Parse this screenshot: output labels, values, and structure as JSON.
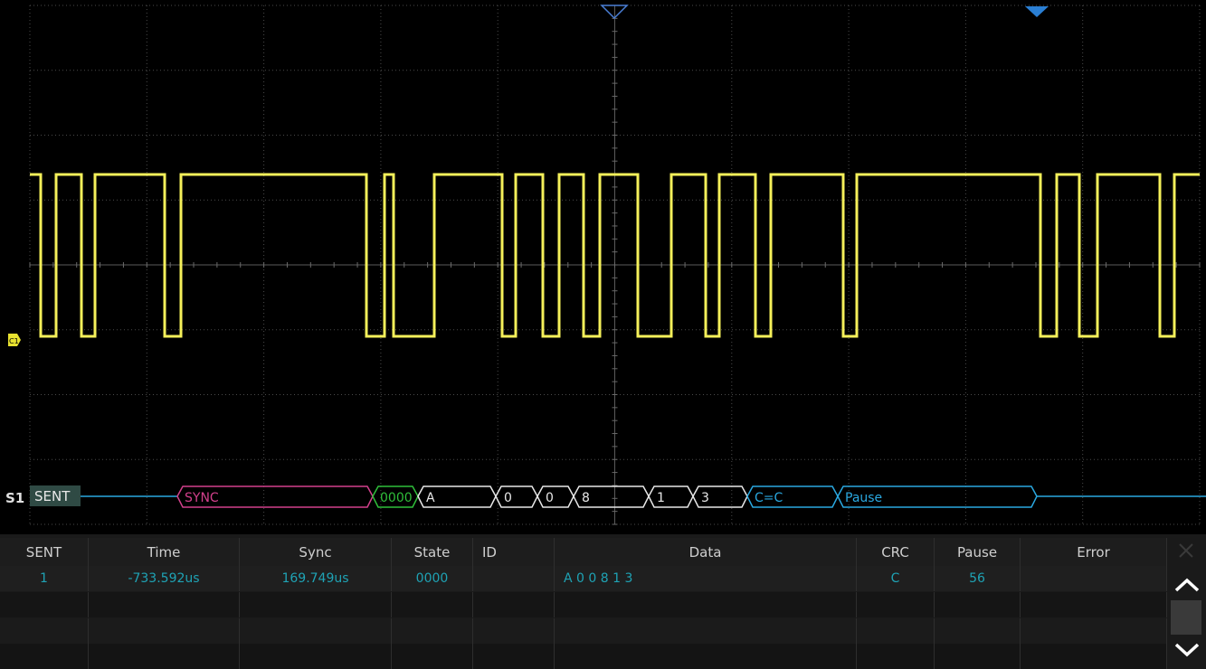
{
  "colors": {
    "grid": "#4a4a4a",
    "trace": "#f5f05a",
    "bus": "#2aa8e0",
    "sync": "#d2408c",
    "status": "#2fbf3a",
    "data": "#e8e8e8",
    "marker": "#2a7fd4"
  },
  "channel": {
    "marker_label": "C1",
    "bus_label": "S1",
    "protocol_badge": "SENT"
  },
  "decode_bus": {
    "sync_label": "SYNC",
    "status_label": "0000",
    "nibbles": [
      "A",
      "0",
      "0",
      "8",
      "1",
      "3"
    ],
    "crc_label": "C=C",
    "pause_label": "Pause"
  },
  "table": {
    "headers": [
      "SENT",
      "Time",
      "Sync",
      "State",
      "ID",
      "Data",
      "CRC",
      "Pause",
      "Error"
    ],
    "rows": [
      [
        "1",
        "-733.592us",
        "169.749us",
        "0000",
        "",
        "A 0 0 8 1 3",
        "C",
        "56",
        ""
      ]
    ]
  },
  "icons": {
    "trigger_position": "trigger-position-icon",
    "horizontal_marker": "horizontal-marker-icon",
    "close": "close-icon",
    "scroll_up": "chevron-up-icon",
    "scroll_down": "chevron-down-icon"
  }
}
